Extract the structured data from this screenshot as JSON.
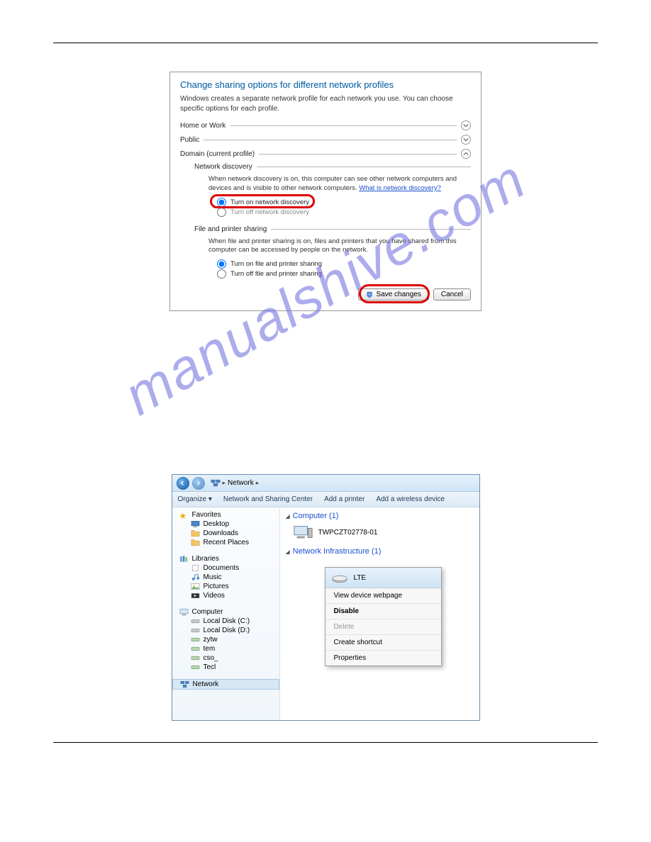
{
  "watermark": "manualshive.com",
  "shot1": {
    "title": "Change sharing options for different network profiles",
    "desc": "Windows creates a separate network profile for each network you use. You can choose specific options for each profile.",
    "profiles": {
      "home": "Home or Work",
      "public": "Public",
      "domain": "Domain (current profile)"
    },
    "network_discovery": {
      "heading": "Network discovery",
      "desc_pre": "When network discovery is on, this computer can see other network computers and devices and is visible to other network computers. ",
      "link": "What is network discovery?",
      "radio_on": "Turn on network discovery",
      "radio_off": "Turn off network discovery"
    },
    "file_printer": {
      "heading": "File and printer sharing",
      "desc": "When file and printer sharing is on, files and printers that you have shared from this computer can be accessed by people on the network.",
      "radio_on": "Turn on file and printer sharing",
      "radio_off": "Turn off file and printer sharing"
    },
    "buttons": {
      "save": "Save changes",
      "cancel": "Cancel"
    }
  },
  "shot2": {
    "breadcrumb": "Network",
    "toolbar": {
      "organize": "Organize ▾",
      "nsc": "Network and Sharing Center",
      "add_printer": "Add a printer",
      "add_wireless": "Add a wireless device"
    },
    "sidebar": {
      "favorites": "Favorites",
      "desktop": "Desktop",
      "downloads": "Downloads",
      "recent": "Recent Places",
      "libraries": "Libraries",
      "documents": "Documents",
      "music": "Music",
      "pictures": "Pictures",
      "videos": "Videos",
      "computer": "Computer",
      "disk_c": "Local Disk (C:)",
      "disk_d": "Local Disk (D:)",
      "n1": "zytw",
      "n2": "tem",
      "n3": "cso_",
      "n4": "Tecl",
      "network": "Network"
    },
    "main": {
      "computer_group": "Computer (1)",
      "computer_item": "TWPCZT02778-01",
      "infra_group": "Network Infrastructure (1)"
    },
    "context": {
      "device": "LTE",
      "view": "View device webpage",
      "disable": "Disable",
      "delete": "Delete",
      "shortcut": "Create shortcut",
      "properties": "Properties"
    }
  }
}
